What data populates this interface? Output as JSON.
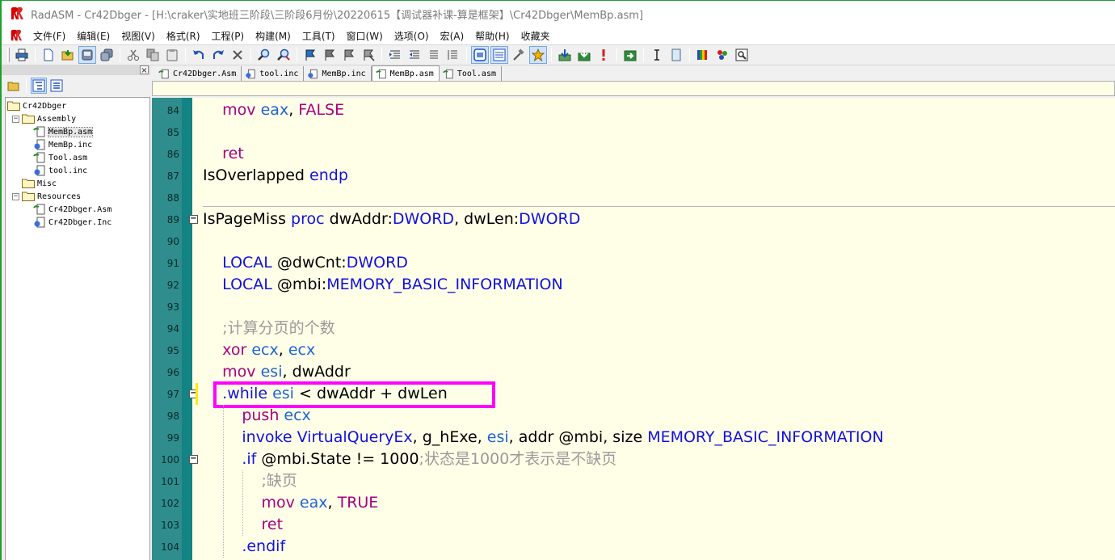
{
  "window": {
    "title": "RadASM - Cr42Dbger - [H:\\craker\\实地班三阶段\\三阶段6月份\\20220615【调试器补课-算是框架】\\Cr42Dbger\\MemBp.asm]"
  },
  "menu": [
    "文件(F)",
    "编辑(E)",
    "视图(V)",
    "格式(R)",
    "工程(P)",
    "构建(M)",
    "工具(T)",
    "窗口(W)",
    "选项(O)",
    "宏(A)",
    "帮助(H)",
    "收藏夹"
  ],
  "tabs": [
    "Cr42Dbger.Asm",
    "tool.inc",
    "MemBp.inc",
    "MemBp.asm",
    "Tool.asm"
  ],
  "active_tab": "MemBp.asm",
  "tree": {
    "root": "Cr42Dbger",
    "groups": [
      {
        "label": "Assembly",
        "files": [
          "MemBp.asm",
          "MemBp.inc",
          "Tool.asm",
          "tool.inc"
        ]
      },
      {
        "label": "Misc",
        "files": []
      },
      {
        "label": "Resources",
        "files": [
          "Cr42Dbger.Asm",
          "Cr42Dbger.Inc"
        ]
      }
    ]
  },
  "editor": {
    "line_numbers": [
      "84",
      "85",
      "86",
      "87",
      "88",
      "89",
      "90",
      "91",
      "92",
      "93",
      "94",
      "95",
      "96",
      "97",
      "98",
      "99",
      "100",
      "101",
      "102",
      "103",
      "104"
    ],
    "lines": [
      [
        {
          "t": "    "
        },
        {
          "t": "mov",
          "c": "kw"
        },
        {
          "t": " "
        },
        {
          "t": "eax",
          "c": "reg"
        },
        {
          "t": ", "
        },
        {
          "t": "FALSE",
          "c": "kw"
        }
      ],
      [],
      [
        {
          "t": "    "
        },
        {
          "t": "ret",
          "c": "kw"
        }
      ],
      [
        {
          "t": "IsOverlapped "
        },
        {
          "t": "endp",
          "c": "type"
        }
      ],
      [],
      [
        {
          "t": "IsPageMiss "
        },
        {
          "t": "proc",
          "c": "type"
        },
        {
          "t": " dwAddr:"
        },
        {
          "t": "DWORD",
          "c": "type"
        },
        {
          "t": ", dwLen:"
        },
        {
          "t": "DWORD",
          "c": "type"
        }
      ],
      [],
      [
        {
          "t": "    "
        },
        {
          "t": "LOCAL",
          "c": "type"
        },
        {
          "t": " @dwCnt:"
        },
        {
          "t": "DWORD",
          "c": "type"
        }
      ],
      [
        {
          "t": "    "
        },
        {
          "t": "LOCAL",
          "c": "type"
        },
        {
          "t": " @mbi:"
        },
        {
          "t": "MEMORY_BASIC_INFORMATION",
          "c": "type"
        }
      ],
      [],
      [
        {
          "t": "    "
        },
        {
          "t": ";计算分页的个数",
          "c": "cmt"
        }
      ],
      [
        {
          "t": "    "
        },
        {
          "t": "xor",
          "c": "kw"
        },
        {
          "t": " "
        },
        {
          "t": "ecx",
          "c": "reg"
        },
        {
          "t": ", "
        },
        {
          "t": "ecx",
          "c": "reg"
        }
      ],
      [
        {
          "t": "    "
        },
        {
          "t": "mov",
          "c": "kw"
        },
        {
          "t": " "
        },
        {
          "t": "esi",
          "c": "reg"
        },
        {
          "t": ", dwAddr"
        }
      ],
      [
        {
          "t": "    "
        },
        {
          "t": ".while",
          "c": "type"
        },
        {
          "t": " "
        },
        {
          "t": "esi",
          "c": "reg"
        },
        {
          "t": " < dwAddr + dwLen"
        }
      ],
      [
        {
          "t": "        "
        },
        {
          "t": "push",
          "c": "kw"
        },
        {
          "t": " "
        },
        {
          "t": "ecx",
          "c": "reg"
        }
      ],
      [
        {
          "t": "        "
        },
        {
          "t": "invoke",
          "c": "type"
        },
        {
          "t": " "
        },
        {
          "t": "VirtualQueryEx",
          "c": "type"
        },
        {
          "t": ", g_hExe, "
        },
        {
          "t": "esi",
          "c": "reg"
        },
        {
          "t": ", addr @mbi, size "
        },
        {
          "t": "MEMORY_BASIC_INFORMATION",
          "c": "type"
        }
      ],
      [
        {
          "t": "        "
        },
        {
          "t": ".if",
          "c": "type"
        },
        {
          "t": " @mbi.State != 1000"
        },
        {
          "t": ";状态是1000才表示是不缺页",
          "c": "cmt"
        }
      ],
      [
        {
          "t": "            "
        },
        {
          "t": ";缺页",
          "c": "cmt"
        }
      ],
      [
        {
          "t": "            "
        },
        {
          "t": "mov",
          "c": "kw"
        },
        {
          "t": " "
        },
        {
          "t": "eax",
          "c": "reg"
        },
        {
          "t": ", "
        },
        {
          "t": "TRUE",
          "c": "kw"
        }
      ],
      [
        {
          "t": "            "
        },
        {
          "t": "ret",
          "c": "kw"
        }
      ],
      [
        {
          "t": "        "
        },
        {
          "t": ".endif",
          "c": "type"
        }
      ]
    ]
  }
}
